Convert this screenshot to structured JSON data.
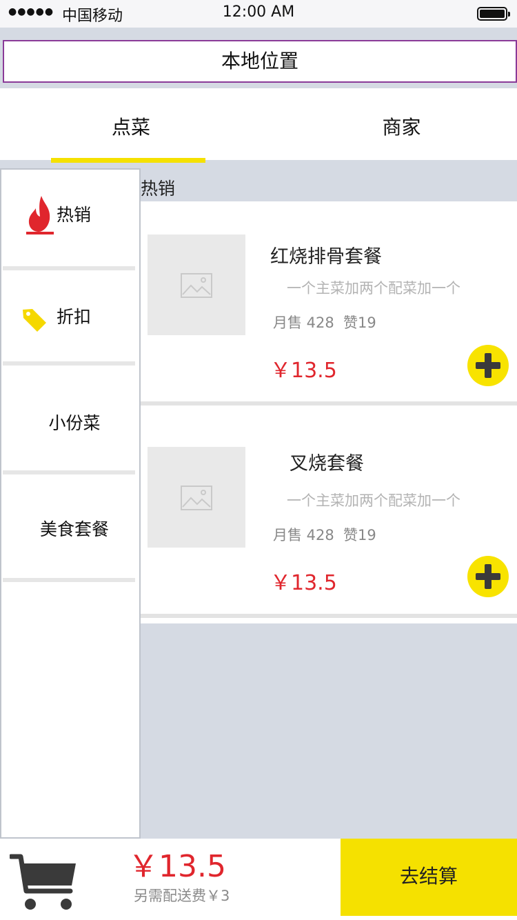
{
  "status_bar": {
    "signal": "●●●●●",
    "carrier": "中国移动",
    "time": "12:00 AM",
    "battery_icon": "battery-full-icon"
  },
  "location": {
    "label": "本地位置"
  },
  "tabs": [
    {
      "label": "点菜",
      "active": true
    },
    {
      "label": "商家",
      "active": false
    }
  ],
  "categories": [
    {
      "label": "热销",
      "icon": "flame-icon",
      "icon_color": "#e0262d"
    },
    {
      "label": "折扣",
      "icon": "price-tag-icon",
      "icon_color": "#f5d800"
    },
    {
      "label": "小份菜"
    },
    {
      "label": "美食套餐"
    }
  ],
  "section": {
    "title": "热销"
  },
  "products": [
    {
      "name": "红烧排骨套餐",
      "description": "一个主菜加两个配菜加一个",
      "sales": "月售 428",
      "likes": "赞19",
      "price": "￥13.5"
    },
    {
      "name": "叉烧套餐",
      "description": "一个主菜加两个配菜加一个",
      "sales": "月售 428",
      "likes": "赞19",
      "price": "￥13.5"
    }
  ],
  "cart": {
    "icon": "shopping-cart-icon",
    "total": "￥13.5",
    "delivery_note": "另需配送费￥3",
    "checkout_label": "去结算"
  },
  "colors": {
    "accent_yellow": "#f5e100",
    "price_red": "#e0262d",
    "background_gray": "#d5dae3"
  }
}
